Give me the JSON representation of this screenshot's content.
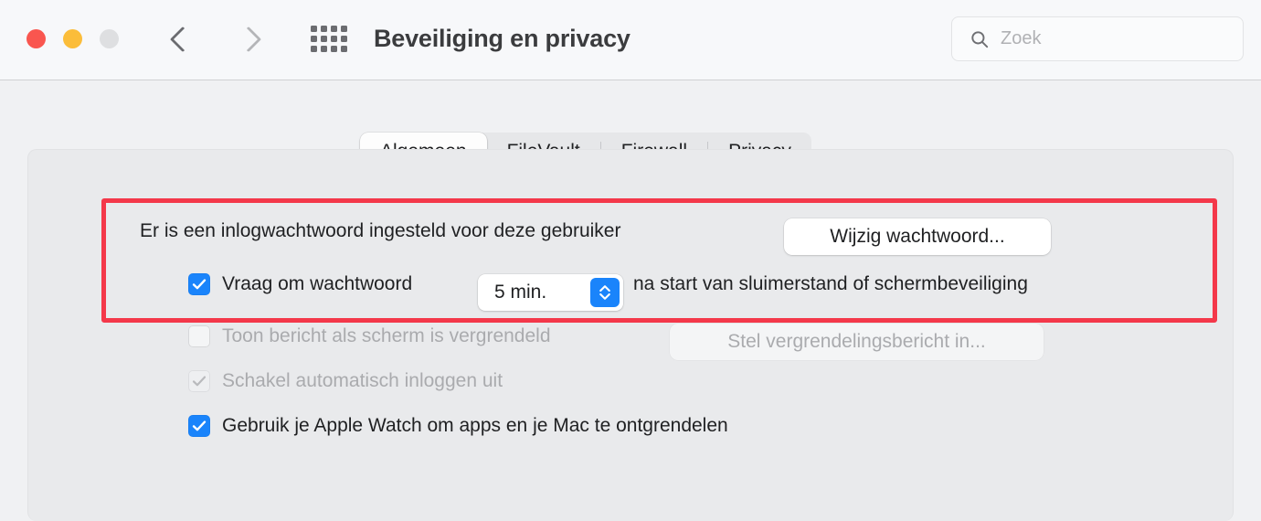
{
  "window": {
    "title": "Beveiliging en privacy",
    "traffic_lights": [
      "close",
      "minimize",
      "zoom"
    ],
    "nav": {
      "back": "back-chevron",
      "forward": "forward-chevron",
      "show_all": "grid-icon"
    }
  },
  "search": {
    "placeholder": "Zoek",
    "value": "",
    "icon": "search-icon"
  },
  "tabs": [
    {
      "label": "Algemeen",
      "active": true
    },
    {
      "label": "FileVault",
      "active": false
    },
    {
      "label": "Firewall",
      "active": false
    },
    {
      "label": "Privacy",
      "active": false
    }
  ],
  "main": {
    "password_status": "Er is een inlogwachtwoord ingesteld voor deze gebruiker",
    "change_password_button": "Wijzig wachtwoord...",
    "require_password": {
      "label": "Vraag om wachtwoord",
      "checked": true,
      "delay_value": "5 min.",
      "suffix": "na start van sluimerstand of schermbeveiliging"
    },
    "lock_message": {
      "label": "Toon bericht als scherm is vergrendeld",
      "checked": false,
      "enabled": false,
      "button": "Stel vergrendelingsbericht in..."
    },
    "disable_auto_login": {
      "label": "Schakel automatisch inloggen uit",
      "checked": true,
      "enabled": false
    },
    "apple_watch": {
      "label": "Gebruik je Apple Watch om apps en je Mac te ontgrendelen",
      "checked": true,
      "enabled": true
    }
  },
  "annotation": {
    "highlight_color": "#f4384a",
    "target": "require-password-section"
  },
  "colors": {
    "accent": "#1a84fb",
    "toolbar_bg": "#f7f8fa",
    "content_bg": "#f0f1f3",
    "panel_bg": "#e9eaec",
    "traffic_red": "#f9564f",
    "traffic_yellow": "#fbbd3a",
    "traffic_gray": "#dedfe1"
  }
}
